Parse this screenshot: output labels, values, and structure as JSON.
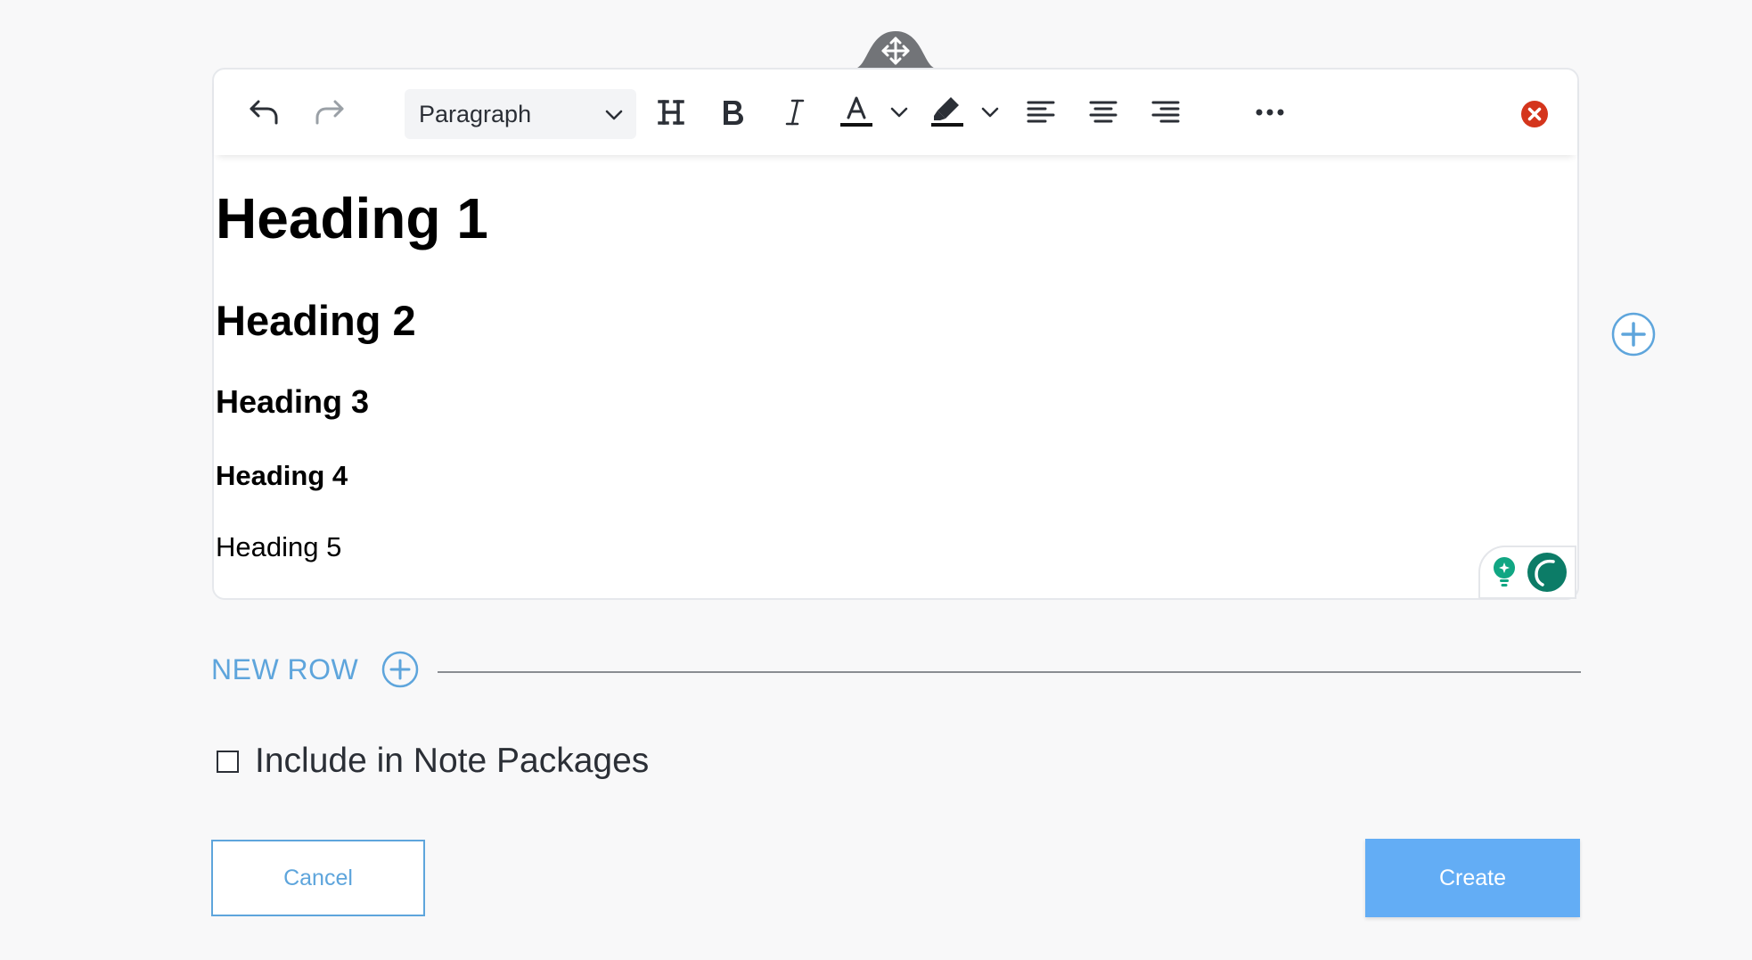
{
  "icons": {
    "drag_handle": "move-arrows-icon",
    "undo": "undo-icon",
    "redo": "redo-icon",
    "heading": "heading-icon",
    "bold": "bold-icon",
    "italic": "italic-icon",
    "font_color": "font-color-icon",
    "highlight": "highlight-icon",
    "align_left": "align-left-icon",
    "align_center": "align-center-icon",
    "align_right": "align-right-icon",
    "more": "more-options-icon",
    "close": "close-circle-icon",
    "add": "plus-circle-icon",
    "grammar": "grammar-assistant-icon"
  },
  "colors": {
    "accent": "#5ea5dc",
    "primary_button": "#63adf5",
    "close": "#d4351c",
    "grammar_green": "#11a683",
    "grammar_dark": "#0c7c67"
  },
  "toolbar": {
    "block_style": "Paragraph"
  },
  "content": {
    "heading1": "Heading 1",
    "heading2": "Heading 2",
    "heading3": "Heading 3",
    "heading4": "Heading 4",
    "heading5": "Heading 5"
  },
  "new_row": {
    "label": "NEW ROW"
  },
  "include_note_packages": {
    "label": "Include in Note Packages",
    "checked": false
  },
  "actions": {
    "cancel_label": "Cancel",
    "create_label": "Create"
  }
}
